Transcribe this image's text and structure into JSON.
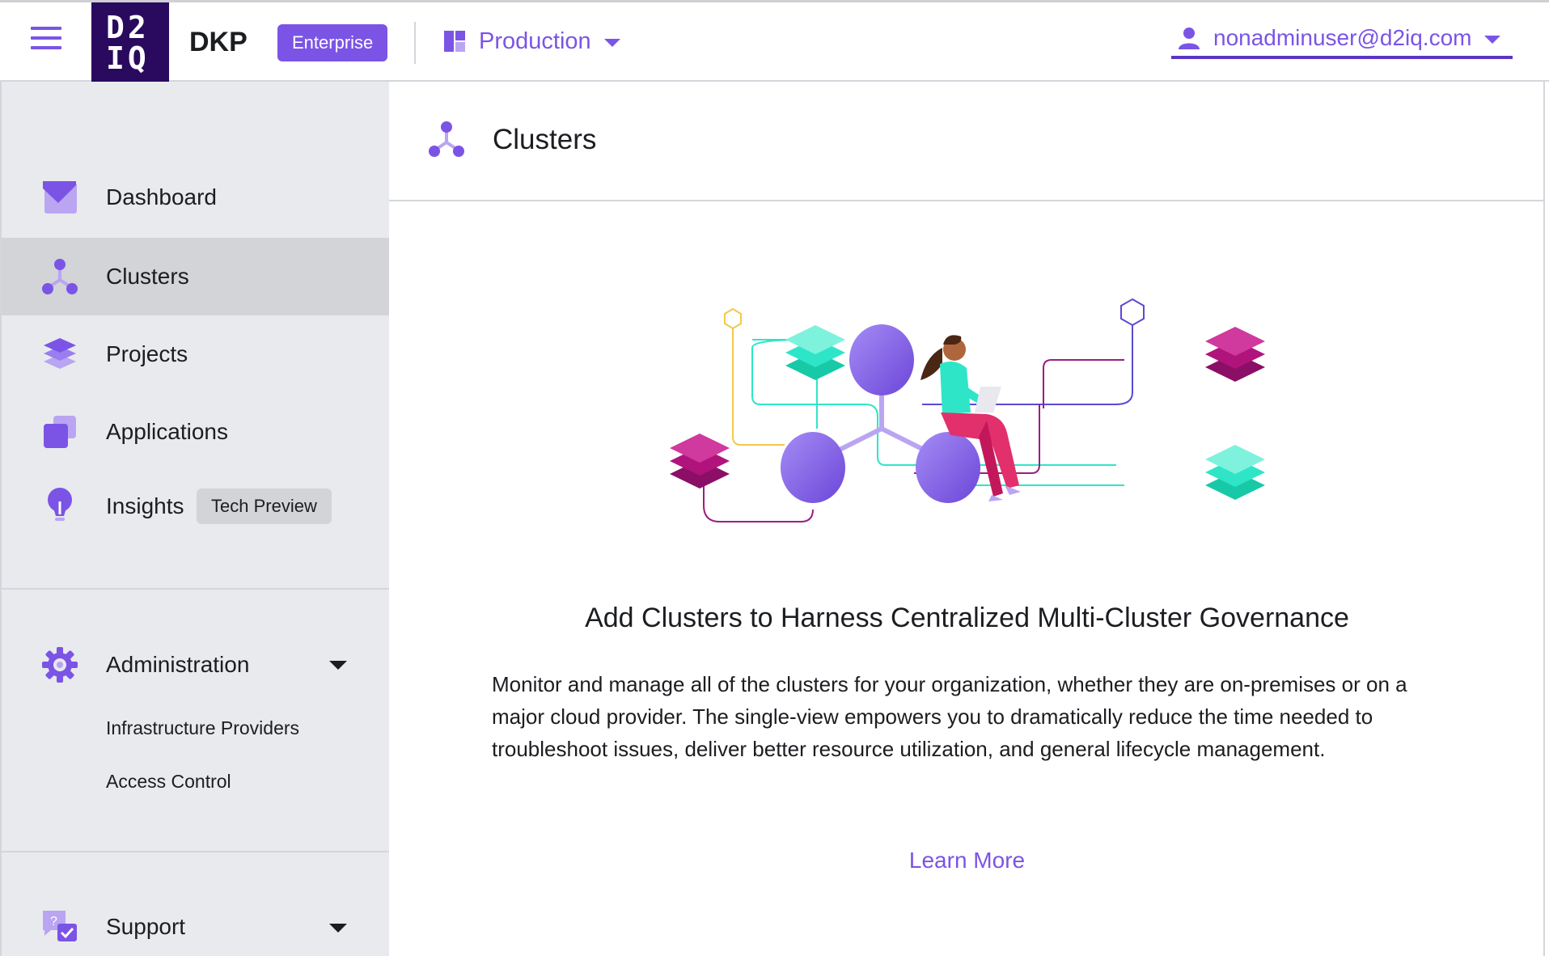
{
  "header": {
    "logo_line1": "D2",
    "logo_line2": "IQ",
    "product": "DKP",
    "edition_badge": "Enterprise",
    "workspace": "Production",
    "user_email": "nonadminuser@d2iq.com"
  },
  "sidebar": {
    "items": [
      {
        "label": "Dashboard",
        "icon": "dashboard-icon"
      },
      {
        "label": "Clusters",
        "icon": "clusters-icon",
        "active": true
      },
      {
        "label": "Projects",
        "icon": "projects-icon"
      },
      {
        "label": "Applications",
        "icon": "applications-icon"
      },
      {
        "label": "Insights",
        "icon": "insights-icon",
        "badge": "Tech Preview"
      }
    ],
    "administration": {
      "label": "Administration",
      "icon": "gear-icon",
      "sub_items": [
        "Infrastructure Providers",
        "Access Control"
      ]
    },
    "support": {
      "label": "Support",
      "icon": "support-icon"
    }
  },
  "main": {
    "title": "Clusters",
    "empty_state": {
      "heading": "Add Clusters to Harness Centralized Multi-Cluster Governance",
      "description": "Monitor and manage all of the clusters for your organization, whether they are on-premises or on a major cloud provider. The single-view empowers you to dramatically reduce the time needed to troubleshoot issues, deliver better resource utilization, and general lifecycle management.",
      "link": "Learn More"
    }
  },
  "colors": {
    "accent": "#7b54e6",
    "logo_bg": "#2a0a5e",
    "sidebar_bg": "#e9eaed",
    "teal": "#2ee6c7",
    "magenta": "#b0137c"
  }
}
